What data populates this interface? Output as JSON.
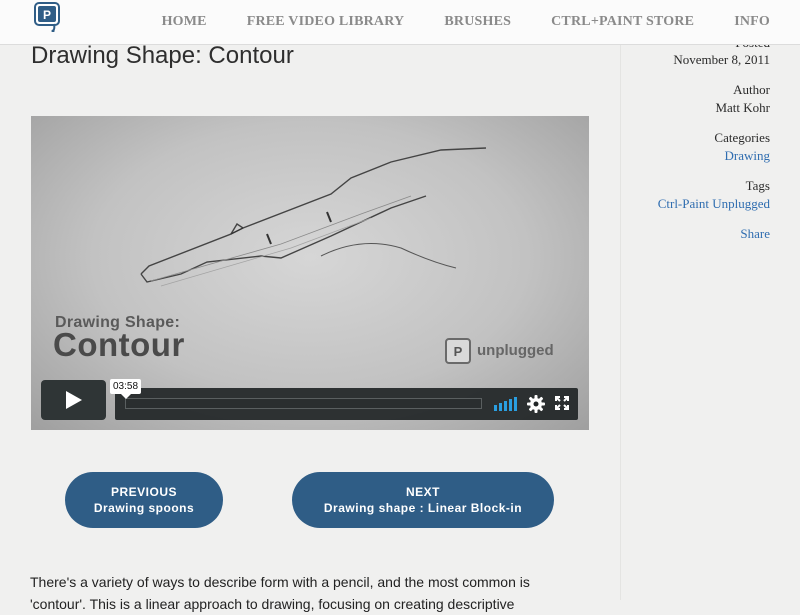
{
  "brand": {
    "logo_letter": "P"
  },
  "nav": {
    "items": [
      {
        "label": "HOME"
      },
      {
        "label": "FREE VIDEO LIBRARY"
      },
      {
        "label": "BRUSHES"
      },
      {
        "label": "CTRL+PAINT STORE"
      },
      {
        "label": "INFO"
      }
    ]
  },
  "post": {
    "title": "Drawing Shape: Contour",
    "intro": "There's a variety of ways to describe form with a pencil, and the most common is 'contour'. This is a linear approach to drawing, focusing on creating descriptive"
  },
  "video": {
    "overlay_small": "Drawing Shape:",
    "overlay_large": "Contour",
    "brand_letter": "P",
    "brand_text": "unplugged",
    "duration": "03:58",
    "progress": 0
  },
  "sidebar": {
    "posted_label": "Posted",
    "date": "November 8, 2011",
    "author_label": "Author",
    "author": "Matt Kohr",
    "categories_label": "Categories",
    "category": "Drawing",
    "tags_label": "Tags",
    "tag": "Ctrl-Paint Unplugged",
    "share_label": "Share"
  },
  "pager": {
    "previous_label": "PREVIOUS",
    "previous_title": "Drawing spoons",
    "next_label": "NEXT",
    "next_title": "Drawing shape : Linear Block-in"
  },
  "colors": {
    "accent": "#2f5d86",
    "link": "#2f6db0",
    "player_bar": "#212526",
    "volume": "#2a9ee0"
  },
  "icons": [
    "logo-icon",
    "play-icon",
    "volume-icon",
    "gear-icon",
    "fullscreen-icon"
  ]
}
